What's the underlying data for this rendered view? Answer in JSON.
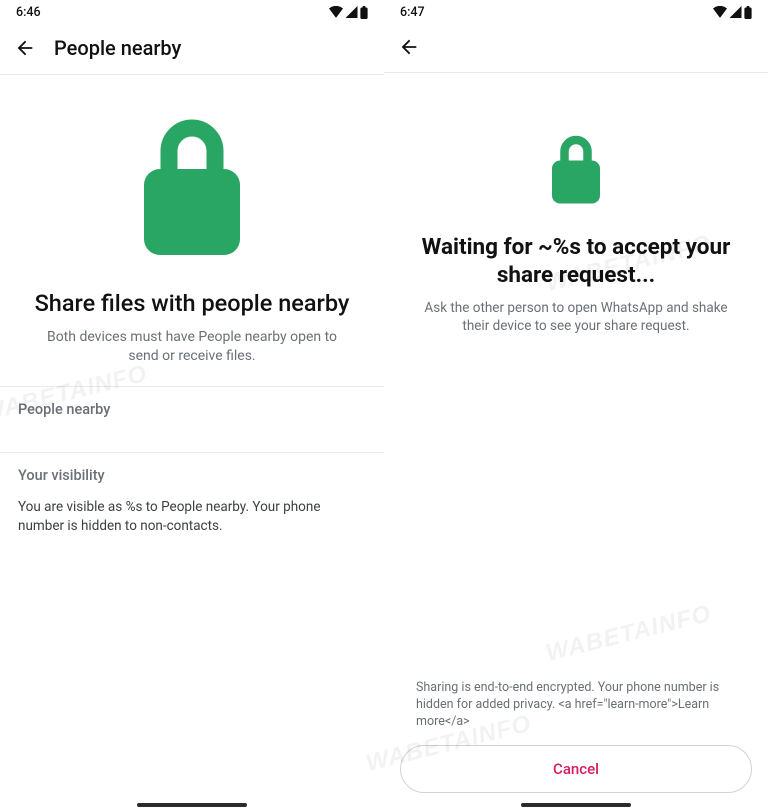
{
  "left": {
    "time": "6:46",
    "title": "People nearby",
    "headline": "Share files with people nearby",
    "subtext": "Both devices must have People nearby open to send or receive files.",
    "section_people": "People nearby",
    "section_visibility": "Your visibility",
    "visibility_body": "You are visible as %s to People nearby. Your phone number is hidden to non-contacts."
  },
  "right": {
    "time": "6:47",
    "headline": "Waiting for ~%s to accept your share request...",
    "subtext": "Ask the other person to open WhatsApp and shake their device to see your share request.",
    "encrypt": "Sharing is end-to-end encrypted. Your phone number is hidden for added privacy. <a href=\"learn-more\">Learn more</a>",
    "cancel": "Cancel"
  },
  "colors": {
    "green": "#2aa664",
    "pink": "#d81b60"
  },
  "watermark": "WABETAINFO"
}
